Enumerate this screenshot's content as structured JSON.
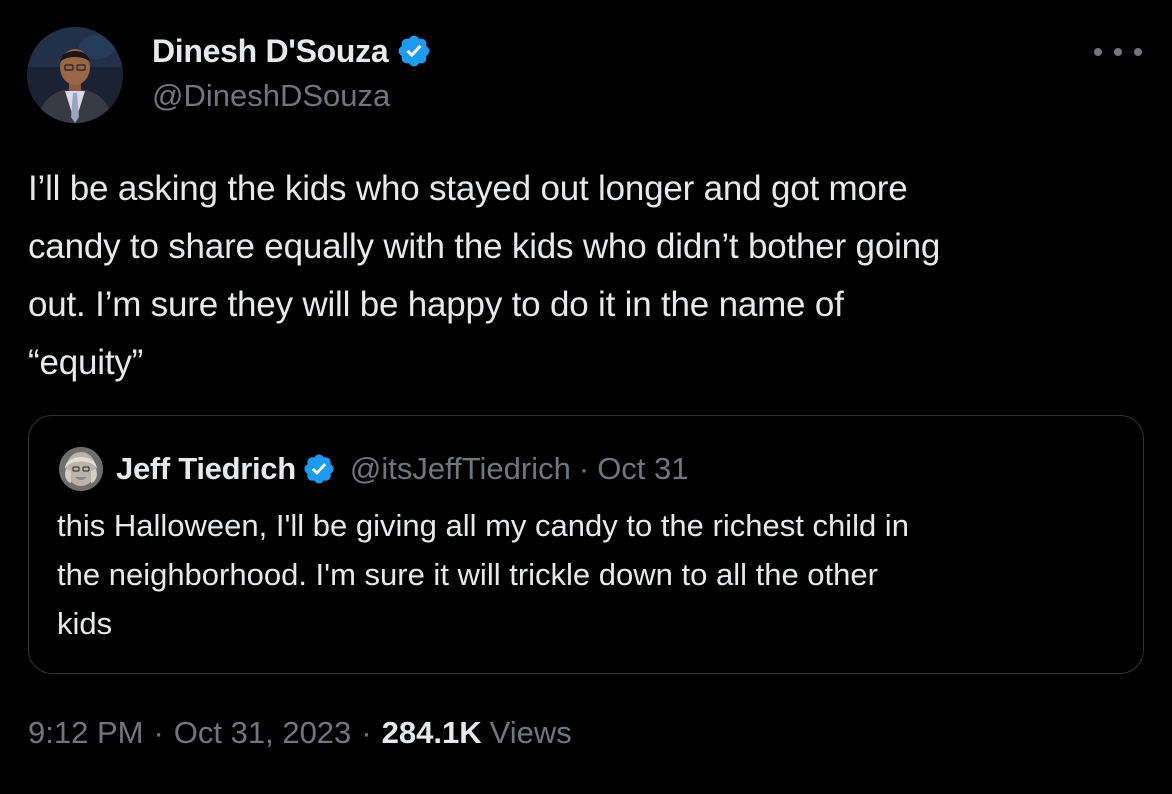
{
  "author": {
    "display_name": "Dinesh D'Souza",
    "handle": "@DineshDSouza",
    "verified_icon": "verified-badge-icon",
    "avatar_icon": "avatar"
  },
  "tweet": {
    "text": "I’ll be asking the kids who stayed out longer and got more\ncandy to share equally with the kids who didn’t bother going\nout. I’m sure they will be happy to do it in the name of\n“equity”"
  },
  "quote": {
    "display_name": "Jeff Tiedrich",
    "handle": "@itsJeffTiedrich",
    "separator": "·",
    "date": "Oct 31",
    "text": "this Halloween, I'll be giving all my candy to the richest child in\nthe neighborhood. I'm sure it will trickle down to all the other\nkids"
  },
  "meta": {
    "time": "9:12 PM",
    "separator": "·",
    "date": "Oct 31, 2023",
    "views_count": "284.1K",
    "views_label": "Views"
  },
  "colors": {
    "background": "#000000",
    "text_primary": "#e7e9ea",
    "text_secondary": "#71767b",
    "verified_blue": "#1d9bf0",
    "border": "#2f3336"
  }
}
